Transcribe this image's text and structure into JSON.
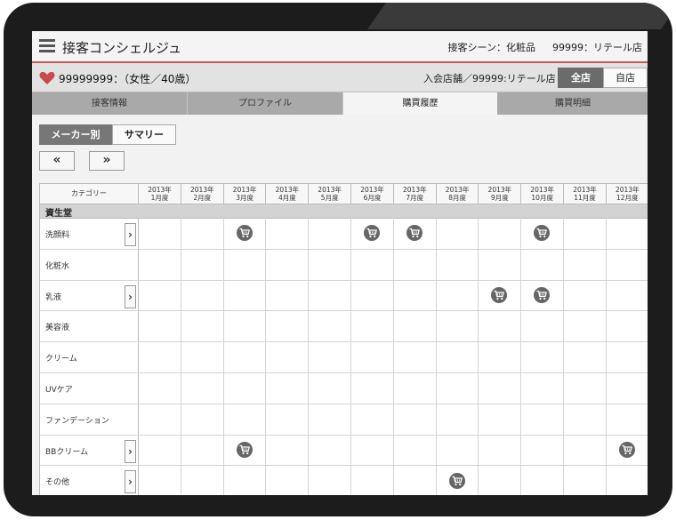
{
  "header": {
    "title": "接客コンシェルジュ",
    "scene": "接客シーン：化粧品",
    "store": "99999：リテール店"
  },
  "customer": {
    "summary": "99999999：（女性／40歳）",
    "join_store": "入会店舗／99999:リテール店",
    "toggle_all": "全店",
    "toggle_own": "自店"
  },
  "tabs": [
    {
      "label": "接客情報"
    },
    {
      "label": "プロファイル"
    },
    {
      "label": "購買履歴"
    },
    {
      "label": "購買明細"
    }
  ],
  "active_tab": "購買履歴",
  "view_toggle": {
    "maker": "メーカー別",
    "summary": "サマリー"
  },
  "nav": {
    "prev": "«",
    "next": "»"
  },
  "grid": {
    "category_header": "カテゴリー",
    "months": [
      {
        "year": "2013年",
        "month": "1月度"
      },
      {
        "year": "2013年",
        "month": "2月度"
      },
      {
        "year": "2013年",
        "month": "3月度"
      },
      {
        "year": "2013年",
        "month": "4月度"
      },
      {
        "year": "2013年",
        "month": "5月度"
      },
      {
        "year": "2013年",
        "month": "6月度"
      },
      {
        "year": "2013年",
        "month": "7月度"
      },
      {
        "year": "2013年",
        "month": "8月度"
      },
      {
        "year": "2013年",
        "month": "9月度"
      },
      {
        "year": "2013年",
        "month": "10月度"
      },
      {
        "year": "2013年",
        "month": "11月度"
      },
      {
        "year": "2013年",
        "month": "12月度"
      }
    ],
    "brand": "資生堂",
    "rows": [
      {
        "label": "洗顔料",
        "has_detail": true,
        "purchases": [
          3,
          6,
          7,
          10
        ]
      },
      {
        "label": "化粧水",
        "has_detail": false,
        "purchases": []
      },
      {
        "label": "乳液",
        "has_detail": true,
        "purchases": [
          9,
          10
        ]
      },
      {
        "label": "美容液",
        "has_detail": false,
        "purchases": []
      },
      {
        "label": "クリーム",
        "has_detail": false,
        "purchases": []
      },
      {
        "label": "UVケア",
        "has_detail": false,
        "purchases": []
      },
      {
        "label": "ファンデーション",
        "has_detail": false,
        "purchases": []
      },
      {
        "label": "BBクリーム",
        "has_detail": true,
        "purchases": [
          3,
          12
        ]
      },
      {
        "label": "その他",
        "has_detail": true,
        "purchases": [
          8
        ]
      }
    ]
  },
  "icons": {
    "menu": "hamburger-icon",
    "heart": "heart-icon",
    "cart": "cart-icon",
    "chevron": "chevron-right-icon"
  },
  "colors": {
    "accent_line": "#c9585a",
    "heart": "#c74b4b",
    "cart_bg": "#666666"
  }
}
